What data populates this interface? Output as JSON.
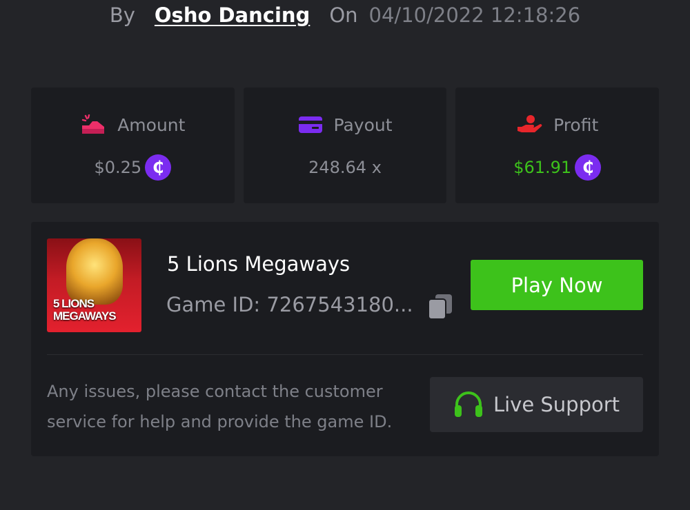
{
  "byline": {
    "by": "By",
    "user": "Osho Dancing",
    "on": "On",
    "datetime": "04/10/2022 12:18:26"
  },
  "stats": [
    {
      "icon": "amount-icon",
      "label": "Amount",
      "value": "$0.25",
      "coin": true,
      "value_color": "#8d8f97",
      "icon_color": "#ec2f69"
    },
    {
      "icon": "payout-card-icon",
      "label": "Payout",
      "value": "248.64 x",
      "coin": false,
      "value_color": "#8d8f97",
      "icon_color": "#7b2cf0"
    },
    {
      "icon": "profit-hand-icon",
      "label": "Profit",
      "value": "$61.91",
      "coin": true,
      "value_color": "#3dc21b",
      "icon_color": "#e8262b"
    }
  ],
  "coin_symbol": "₵",
  "game": {
    "name": "5 Lions Megaways",
    "id_text": "Game ID: 7267543180...",
    "thumbnail_text_line1": "5 LIONS",
    "thumbnail_text_line2": "MEGAWAYS",
    "play_label": "Play Now"
  },
  "support": {
    "notice": "Any issues, please contact the customer service for help and provide the game ID.",
    "button_label": "Live Support"
  },
  "colors": {
    "background": "#232428",
    "card": "#1b1c20",
    "accent_green": "#3dc21b",
    "coin_purple": "#7b2cf0"
  }
}
